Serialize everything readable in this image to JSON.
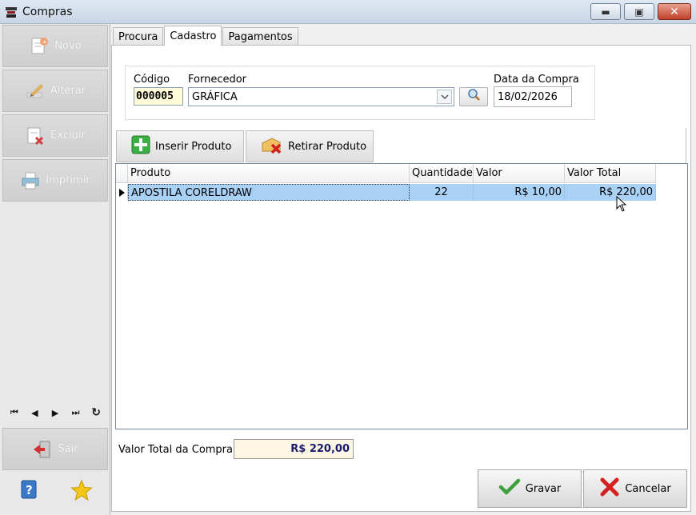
{
  "window": {
    "title": "Compras",
    "minimize_glyph": "▬",
    "maximize_glyph": "▣",
    "close_glyph": "✕"
  },
  "sidebar": {
    "buttons": [
      {
        "label": "Novo",
        "icon": "new-document-icon"
      },
      {
        "label": "Alterar",
        "icon": "edit-pencil-icon"
      },
      {
        "label": "Excluir",
        "icon": "delete-document-icon"
      },
      {
        "label": "Imprimir",
        "icon": "printer-icon"
      }
    ],
    "nav": {
      "first": "⏮",
      "prev": "◀",
      "next": "▶",
      "last": "⏭",
      "refresh": "↻"
    },
    "exit_label": "Sair",
    "bottom_icons": [
      "help-book-icon",
      "star-icon"
    ]
  },
  "tabs": [
    "Procura",
    "Cadastro",
    "Pagamentos"
  ],
  "active_tab": "Cadastro",
  "form": {
    "codigo_label": "Código",
    "codigo_value": "000005",
    "fornecedor_label": "Fornecedor",
    "fornecedor_value": "GRÁFICA",
    "data_label": "Data da Compra",
    "data_value": "18/02/2026"
  },
  "product_buttons": {
    "insert": "Inserir Produto",
    "remove": "Retirar Produto"
  },
  "grid": {
    "columns": [
      "Produto",
      "Quantidade",
      "Valor",
      "Valor Total"
    ],
    "rows": [
      {
        "produto": "APOSTILA CORELDRAW",
        "quantidade": "22",
        "valor": "R$ 10,00",
        "valor_total": "R$ 220,00"
      }
    ]
  },
  "footer": {
    "total_label": "Valor Total da Compra:",
    "total_value": "R$ 220,00",
    "save_label": "Gravar",
    "cancel_label": "Cancelar"
  },
  "colors": {
    "selection": "#a9d0f5",
    "total_text": "#1a1a6e",
    "code_bg": "#fffbd8"
  }
}
